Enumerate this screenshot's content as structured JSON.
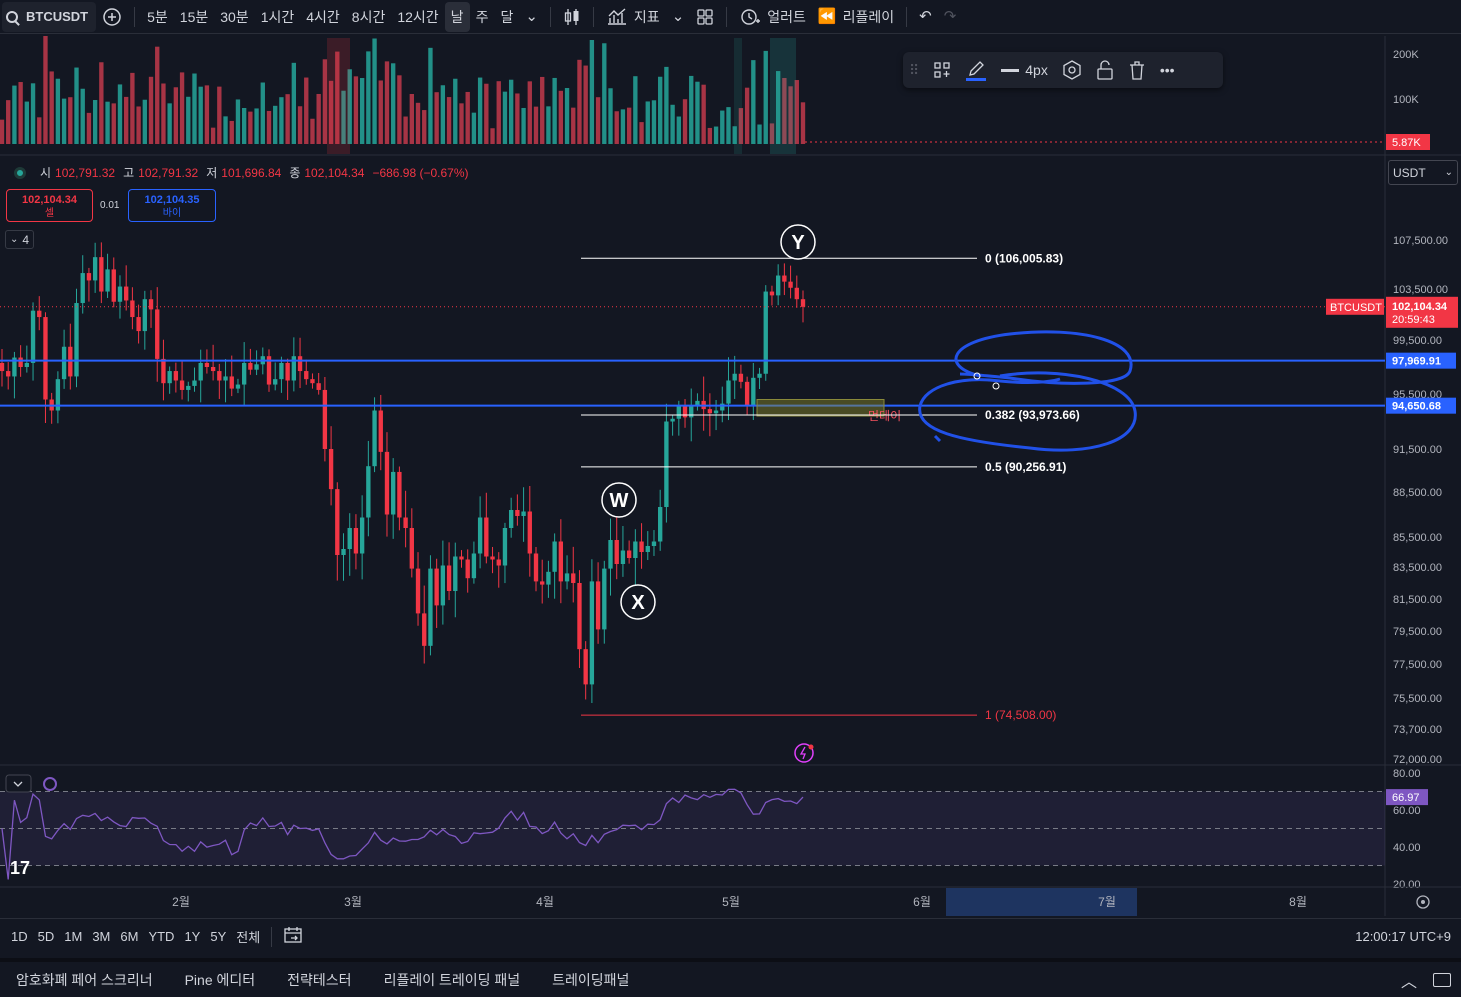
{
  "toolbar": {
    "symbol": "BTCUSDT",
    "intervals": [
      "5분",
      "15분",
      "30분",
      "1시간",
      "4시간",
      "8시간",
      "12시간",
      "날",
      "주",
      "달"
    ],
    "active_interval": "날",
    "indicators_label": "지표",
    "alert_label": "얼러트",
    "replay_label": "리플레이"
  },
  "ohlc": {
    "open_label": "시",
    "open": "102,791.32",
    "high_label": "고",
    "high": "102,791.32",
    "low_label": "저",
    "low": "101,696.84",
    "close_label": "종",
    "close": "102,104.34",
    "change": "−686.98 (−0.67%)"
  },
  "quote": {
    "sell_price": "102,104.34",
    "sell_label": "셀",
    "buy_price": "102,104.35",
    "buy_label": "바이",
    "spread": "0.01"
  },
  "indicator_count": "4",
  "currency": "USDT",
  "drawing_toolbar": {
    "width_label": "4px"
  },
  "colors": {
    "bg": "#131722",
    "up": "#26a69a",
    "down": "#f23645",
    "hline": "#2962ff",
    "rsi": "#7e57c2",
    "annotation": "#2151e8",
    "accent": "#2962ff"
  },
  "chart_data": {
    "type": "candlestick",
    "symbol": "BTCUSDT",
    "timeframe": "1D",
    "price_axis": {
      "ticks": [
        "107,500.00",
        "103,500.00",
        "99,500.00",
        "95,500.00",
        "91,500.00",
        "88,500.00",
        "85,500.00",
        "83,500.00",
        "81,500.00",
        "79,500.00",
        "77,500.00",
        "75,500.00",
        "73,700.00",
        "72,000.00"
      ],
      "tick_values": [
        107500,
        103500,
        99500,
        95500,
        91500,
        88500,
        85500,
        83500,
        81500,
        79500,
        77500,
        75500,
        73700,
        72000
      ],
      "ylim": [
        72000,
        109000
      ]
    },
    "time_axis": {
      "labels": [
        "2월",
        "3월",
        "4월",
        "5월",
        "6월",
        "7월",
        "8월"
      ]
    },
    "volume_axis": {
      "ticks": [
        "200K",
        "100K"
      ],
      "tick_values": [
        200000,
        100000
      ],
      "last_volume": "5.87K"
    },
    "last_price": {
      "symbol": "BTCUSDT",
      "price": "102,104.34",
      "countdown": "20:59:43",
      "value": 102104.34
    },
    "horizontal_lines": [
      {
        "price": 97969.91,
        "label": "97,969.91"
      },
      {
        "price": 94650.68,
        "label": "94,650.68"
      }
    ],
    "fibonacci": [
      {
        "level": "0",
        "value": 106005.83,
        "label": "0 (106,005.83)"
      },
      {
        "level": "0.382",
        "value": 93973.66,
        "label": "0.382 (93,973.66)"
      },
      {
        "level": "0.5",
        "value": 90256.91,
        "label": "0.5 (90,256.91)"
      },
      {
        "level": "1",
        "value": 74508.0,
        "label": "1 (74,508.00)"
      }
    ],
    "wave_labels": [
      "W",
      "X",
      "Y"
    ],
    "zone_label": "먼데이",
    "close_prices": [
      97200,
      96800,
      98200,
      97500,
      97800,
      101800,
      101300,
      95100,
      94300,
      96600,
      99000,
      96800,
      102400,
      104800,
      104200,
      106100,
      103300,
      105100,
      102500,
      103700,
      102600,
      101300,
      100200,
      102700,
      101900,
      98100,
      96300,
      97200,
      96500,
      95800,
      96100,
      96500,
      97800,
      97500,
      97200,
      96500,
      96800,
      95900,
      96200,
      97800,
      97300,
      97700,
      98300,
      96200,
      96600,
      97800,
      96500,
      98300,
      97200,
      96600,
      96300,
      95800,
      91500,
      88700,
      84300,
      84700,
      86100,
      84400,
      86800,
      90300,
      94300,
      91300,
      87000,
      89900,
      86800,
      86100,
      83400,
      80600,
      78600,
      83400,
      81100,
      83600,
      82000,
      84200,
      84000,
      82800,
      84400,
      86800,
      84200,
      84000,
      83600,
      86100,
      87300,
      86900,
      87200,
      84400,
      82600,
      82400,
      83200,
      85200,
      82600,
      83100,
      82500,
      78400,
      76300,
      82600,
      79600,
      83400,
      85300,
      83700,
      84600,
      84100,
      85200,
      84500,
      84900,
      85200,
      87500,
      93500,
      93700,
      94700,
      93800,
      94600,
      95000,
      94400,
      94100,
      94300,
      94800,
      96500,
      97000,
      96400,
      94700,
      96700,
      97000,
      103300,
      103000,
      104600,
      104100,
      103600,
      102700,
      102104
    ],
    "rsi": {
      "ticks": [
        "80.00",
        "60.00",
        "40.00",
        "20.00"
      ],
      "tick_values": [
        80,
        60,
        40,
        20
      ],
      "upper_band": 70,
      "middle": 50,
      "lower_band": 30,
      "last_value": "66.97"
    }
  },
  "range_bar": {
    "ranges": [
      "1D",
      "5D",
      "1M",
      "3M",
      "6M",
      "YTD",
      "1Y",
      "5Y",
      "전체"
    ],
    "time": "12:00:17 UTC+9"
  },
  "bottom_tabs": [
    "암호화폐 페어 스크리너",
    "Pine 에디터",
    "전략테스터",
    "리플레이 트레이딩 패널",
    "트레이딩패널"
  ]
}
